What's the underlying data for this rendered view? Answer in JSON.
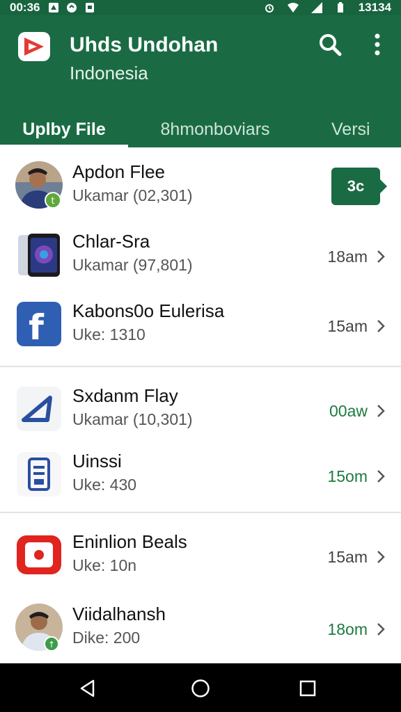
{
  "status_bar": {
    "time": "00:36",
    "clock_right": "13134"
  },
  "app_bar": {
    "title": "Uhds Undohan",
    "subtitle": "Indonesia",
    "color": "#1a6b44"
  },
  "tabs": [
    {
      "label": "Uplby File",
      "active": true
    },
    {
      "label": "8hmonboviars",
      "active": false
    },
    {
      "label": "Versi",
      "active": false
    }
  ],
  "rows": [
    {
      "title": "Apdon Flee",
      "subtitle": "Ukamar (02,301)",
      "badge": "3c",
      "avatar_icon": "person-photo-icon"
    },
    {
      "title": "Chlar-Sra",
      "subtitle": "Ukamar (97,801)",
      "time": "18am",
      "time_color": "#444444",
      "avatar_icon": "phone-icon"
    },
    {
      "title": "Kabons0o Eulerisa",
      "subtitle": "Uke: 1310",
      "time": "15am",
      "time_color": "#444444",
      "avatar_icon": "facebook-icon"
    },
    {
      "title": "Sxdanm Flay",
      "subtitle": "Ukamar (10,301)",
      "time": "00aw",
      "time_color": "#1e7a3f",
      "avatar_icon": "sail-icon"
    },
    {
      "title": "Uinssi",
      "subtitle": "Uke: 430",
      "time": "15om",
      "time_color": "#1e7a3f",
      "avatar_icon": "server-icon"
    },
    {
      "title": "Eninlion Beals",
      "subtitle": "Uke: 10n",
      "time": "15am",
      "time_color": "#444444",
      "avatar_icon": "record-icon"
    },
    {
      "title": "Viidalhansh",
      "subtitle": "Dike: 200",
      "time": "18om",
      "time_color": "#1e7a3f",
      "avatar_icon": "person-photo-icon"
    }
  ]
}
